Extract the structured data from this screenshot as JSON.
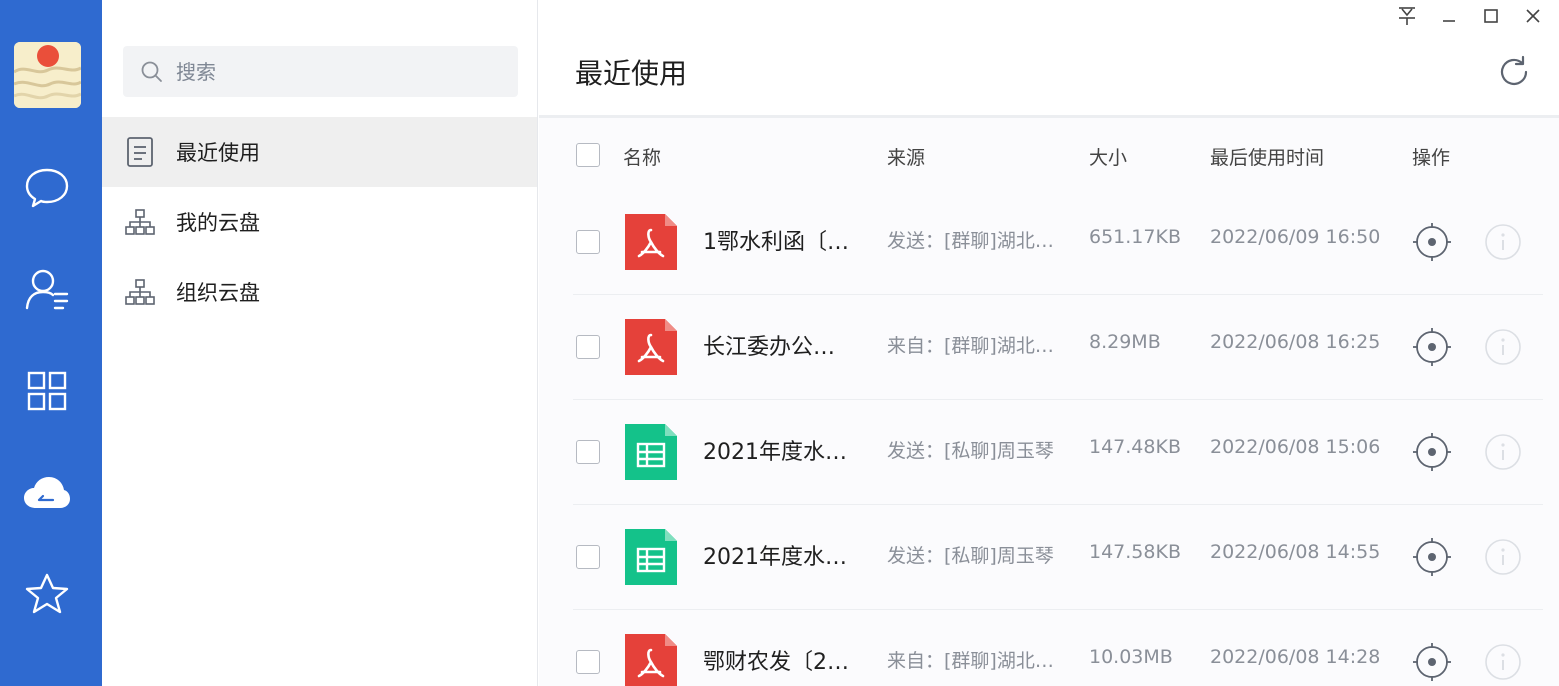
{
  "rail": {
    "avatar": "user-avatar",
    "icons": [
      "chat-icon",
      "contacts-icon",
      "apps-icon",
      "cloud-drive-icon",
      "star-icon"
    ],
    "color": "#2f6ad0"
  },
  "search": {
    "placeholder": "搜索",
    "value": ""
  },
  "nav": {
    "items": [
      {
        "label": "最近使用",
        "icon": "document-icon",
        "active": true
      },
      {
        "label": "我的云盘",
        "icon": "org-tree-icon",
        "active": false
      },
      {
        "label": "组织云盘",
        "icon": "org-tree-icon",
        "active": false
      }
    ]
  },
  "main": {
    "title": "最近使用",
    "window_controls": [
      "pin-icon",
      "minimize-icon",
      "maximize-icon",
      "close-icon"
    ],
    "columns": {
      "name": "名称",
      "source": "来源",
      "size": "大小",
      "last_used": "最后使用时间",
      "action": "操作"
    },
    "files": [
      {
        "type": "pdf",
        "name": "1鄂水利函〔…",
        "source": "发送：[群聊]湖北…",
        "size": "651.17KB",
        "time": "2022/06/09 16:50"
      },
      {
        "type": "pdf",
        "name": "长江委办公…",
        "source": "来自：[群聊]湖北…",
        "size": "8.29MB",
        "time": "2022/06/08 16:25"
      },
      {
        "type": "sheet",
        "name": "2021年度水…",
        "source": "发送：[私聊]周玉琴",
        "size": "147.48KB",
        "time": "2022/06/08 15:06"
      },
      {
        "type": "sheet",
        "name": "2021年度水…",
        "source": "发送：[私聊]周玉琴",
        "size": "147.58KB",
        "time": "2022/06/08 14:55"
      },
      {
        "type": "pdf",
        "name": "鄂财农发〔2…",
        "source": "来自：[群聊]湖北…",
        "size": "10.03MB",
        "time": "2022/06/08 14:28"
      }
    ]
  },
  "colors": {
    "pdf": "#e5413a",
    "sheet": "#14c28a",
    "accent": "#2f6ad0"
  }
}
